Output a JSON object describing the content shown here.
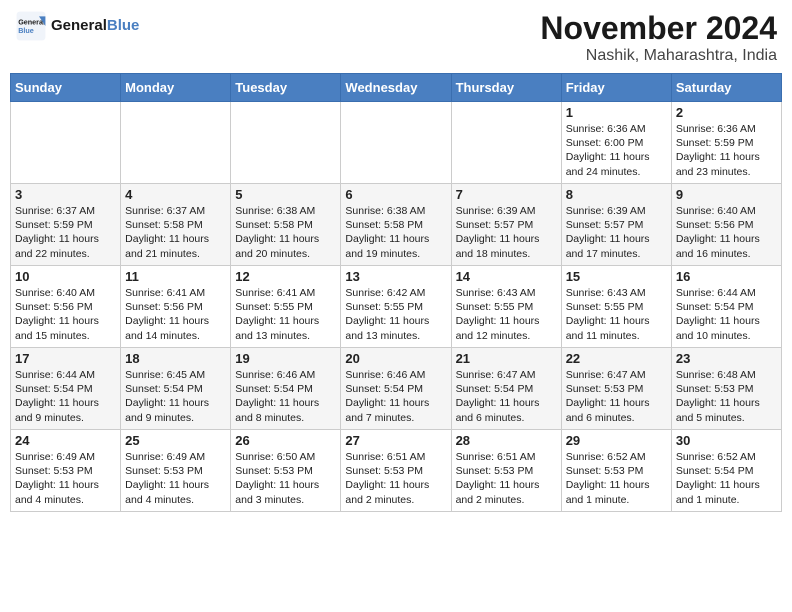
{
  "header": {
    "logo_line1": "General",
    "logo_line2": "Blue",
    "month": "November 2024",
    "location": "Nashik, Maharashtra, India"
  },
  "days_of_week": [
    "Sunday",
    "Monday",
    "Tuesday",
    "Wednesday",
    "Thursday",
    "Friday",
    "Saturday"
  ],
  "weeks": [
    [
      {
        "day": "",
        "info": ""
      },
      {
        "day": "",
        "info": ""
      },
      {
        "day": "",
        "info": ""
      },
      {
        "day": "",
        "info": ""
      },
      {
        "day": "",
        "info": ""
      },
      {
        "day": "1",
        "info": "Sunrise: 6:36 AM\nSunset: 6:00 PM\nDaylight: 11 hours and 24 minutes."
      },
      {
        "day": "2",
        "info": "Sunrise: 6:36 AM\nSunset: 5:59 PM\nDaylight: 11 hours and 23 minutes."
      }
    ],
    [
      {
        "day": "3",
        "info": "Sunrise: 6:37 AM\nSunset: 5:59 PM\nDaylight: 11 hours and 22 minutes."
      },
      {
        "day": "4",
        "info": "Sunrise: 6:37 AM\nSunset: 5:58 PM\nDaylight: 11 hours and 21 minutes."
      },
      {
        "day": "5",
        "info": "Sunrise: 6:38 AM\nSunset: 5:58 PM\nDaylight: 11 hours and 20 minutes."
      },
      {
        "day": "6",
        "info": "Sunrise: 6:38 AM\nSunset: 5:58 PM\nDaylight: 11 hours and 19 minutes."
      },
      {
        "day": "7",
        "info": "Sunrise: 6:39 AM\nSunset: 5:57 PM\nDaylight: 11 hours and 18 minutes."
      },
      {
        "day": "8",
        "info": "Sunrise: 6:39 AM\nSunset: 5:57 PM\nDaylight: 11 hours and 17 minutes."
      },
      {
        "day": "9",
        "info": "Sunrise: 6:40 AM\nSunset: 5:56 PM\nDaylight: 11 hours and 16 minutes."
      }
    ],
    [
      {
        "day": "10",
        "info": "Sunrise: 6:40 AM\nSunset: 5:56 PM\nDaylight: 11 hours and 15 minutes."
      },
      {
        "day": "11",
        "info": "Sunrise: 6:41 AM\nSunset: 5:56 PM\nDaylight: 11 hours and 14 minutes."
      },
      {
        "day": "12",
        "info": "Sunrise: 6:41 AM\nSunset: 5:55 PM\nDaylight: 11 hours and 13 minutes."
      },
      {
        "day": "13",
        "info": "Sunrise: 6:42 AM\nSunset: 5:55 PM\nDaylight: 11 hours and 13 minutes."
      },
      {
        "day": "14",
        "info": "Sunrise: 6:43 AM\nSunset: 5:55 PM\nDaylight: 11 hours and 12 minutes."
      },
      {
        "day": "15",
        "info": "Sunrise: 6:43 AM\nSunset: 5:55 PM\nDaylight: 11 hours and 11 minutes."
      },
      {
        "day": "16",
        "info": "Sunrise: 6:44 AM\nSunset: 5:54 PM\nDaylight: 11 hours and 10 minutes."
      }
    ],
    [
      {
        "day": "17",
        "info": "Sunrise: 6:44 AM\nSunset: 5:54 PM\nDaylight: 11 hours and 9 minutes."
      },
      {
        "day": "18",
        "info": "Sunrise: 6:45 AM\nSunset: 5:54 PM\nDaylight: 11 hours and 9 minutes."
      },
      {
        "day": "19",
        "info": "Sunrise: 6:46 AM\nSunset: 5:54 PM\nDaylight: 11 hours and 8 minutes."
      },
      {
        "day": "20",
        "info": "Sunrise: 6:46 AM\nSunset: 5:54 PM\nDaylight: 11 hours and 7 minutes."
      },
      {
        "day": "21",
        "info": "Sunrise: 6:47 AM\nSunset: 5:54 PM\nDaylight: 11 hours and 6 minutes."
      },
      {
        "day": "22",
        "info": "Sunrise: 6:47 AM\nSunset: 5:53 PM\nDaylight: 11 hours and 6 minutes."
      },
      {
        "day": "23",
        "info": "Sunrise: 6:48 AM\nSunset: 5:53 PM\nDaylight: 11 hours and 5 minutes."
      }
    ],
    [
      {
        "day": "24",
        "info": "Sunrise: 6:49 AM\nSunset: 5:53 PM\nDaylight: 11 hours and 4 minutes."
      },
      {
        "day": "25",
        "info": "Sunrise: 6:49 AM\nSunset: 5:53 PM\nDaylight: 11 hours and 4 minutes."
      },
      {
        "day": "26",
        "info": "Sunrise: 6:50 AM\nSunset: 5:53 PM\nDaylight: 11 hours and 3 minutes."
      },
      {
        "day": "27",
        "info": "Sunrise: 6:51 AM\nSunset: 5:53 PM\nDaylight: 11 hours and 2 minutes."
      },
      {
        "day": "28",
        "info": "Sunrise: 6:51 AM\nSunset: 5:53 PM\nDaylight: 11 hours and 2 minutes."
      },
      {
        "day": "29",
        "info": "Sunrise: 6:52 AM\nSunset: 5:53 PM\nDaylight: 11 hours and 1 minute."
      },
      {
        "day": "30",
        "info": "Sunrise: 6:52 AM\nSunset: 5:54 PM\nDaylight: 11 hours and 1 minute."
      }
    ]
  ]
}
